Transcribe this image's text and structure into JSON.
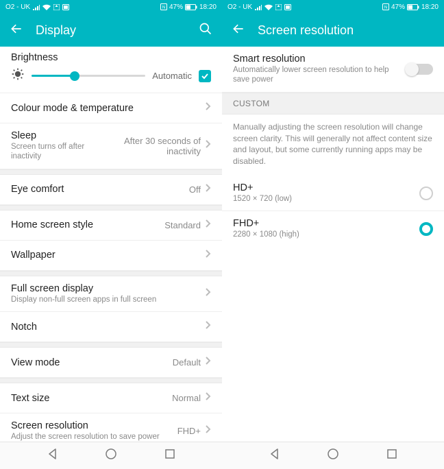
{
  "colors": {
    "accent": "#00b7c2"
  },
  "status": {
    "carrier": "O2 - UK",
    "battery_text": "47%",
    "time": "18:20"
  },
  "left": {
    "title": "Display",
    "brightness": {
      "label": "Brightness",
      "value_pct": 38,
      "auto_label": "Automatic",
      "auto_checked": true
    },
    "rows": {
      "color_mode": {
        "title": "Colour mode & temperature"
      },
      "sleep": {
        "title": "Sleep",
        "sub": "Screen turns off after inactivity",
        "value": "After 30 seconds of inactivity"
      },
      "eye_comfort": {
        "title": "Eye comfort",
        "value": "Off"
      },
      "home_style": {
        "title": "Home screen style",
        "value": "Standard"
      },
      "wallpaper": {
        "title": "Wallpaper"
      },
      "full_screen": {
        "title": "Full screen display",
        "sub": "Display non-full screen apps in full screen"
      },
      "notch": {
        "title": "Notch"
      },
      "view_mode": {
        "title": "View mode",
        "value": "Default"
      },
      "text_size": {
        "title": "Text size",
        "value": "Normal"
      },
      "resolution": {
        "title": "Screen resolution",
        "sub": "Adjust the screen resolution to save power",
        "value": "FHD+"
      }
    }
  },
  "right": {
    "title": "Screen resolution",
    "smart": {
      "title": "Smart resolution",
      "sub": "Automatically lower screen resolution to help save power",
      "on": false
    },
    "section_header": "CUSTOM",
    "info": "Manually adjusting the screen resolution will change screen clarity. This will generally not affect content size and layout, but some currently running apps may be disabled.",
    "options": {
      "hd": {
        "title": "HD+",
        "sub": "1520 × 720 (low)",
        "selected": false
      },
      "fhd": {
        "title": "FHD+",
        "sub": "2280 × 1080 (high)",
        "selected": true
      }
    }
  }
}
